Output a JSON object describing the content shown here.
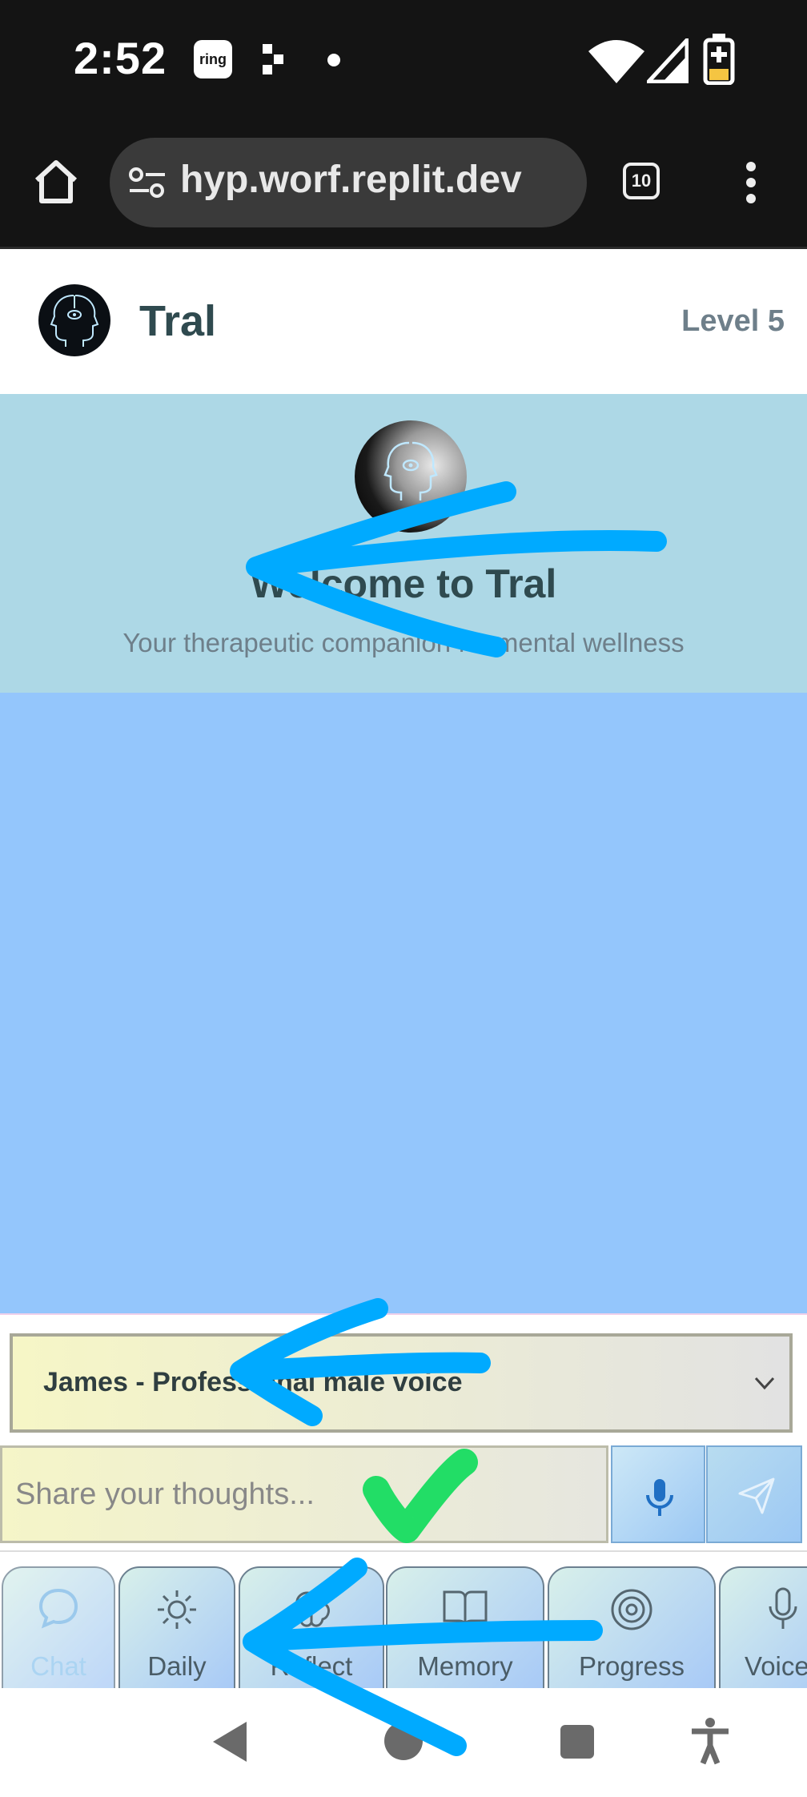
{
  "status_bar": {
    "time": "2:52",
    "ring_label": "ring"
  },
  "browser": {
    "url": "hyp.worf.replit.dev",
    "tab_count": "10"
  },
  "header": {
    "app_name": "Tral",
    "level": "Level 5"
  },
  "welcome": {
    "title": "Welcome to Tral",
    "subtitle": "Your therapeutic companion for mental wellness"
  },
  "voice_select": {
    "selected": "James - Professional male voice"
  },
  "composer": {
    "placeholder": "Share your thoughts..."
  },
  "bottom_nav": [
    {
      "label": "Chat",
      "icon": "chat-bubble-icon"
    },
    {
      "label": "Daily",
      "icon": "sun-icon"
    },
    {
      "label": "Reflect",
      "icon": "brain-icon"
    },
    {
      "label": "Memory",
      "icon": "book-icon"
    },
    {
      "label": "Progress",
      "icon": "target-icon"
    },
    {
      "label": "Voice",
      "icon": "mic-icon"
    }
  ],
  "colors": {
    "accent": "#add8e6",
    "chat_bg": "#94c6fc",
    "annotation_blue": "#00aaff",
    "annotation_green": "#22dd66"
  }
}
